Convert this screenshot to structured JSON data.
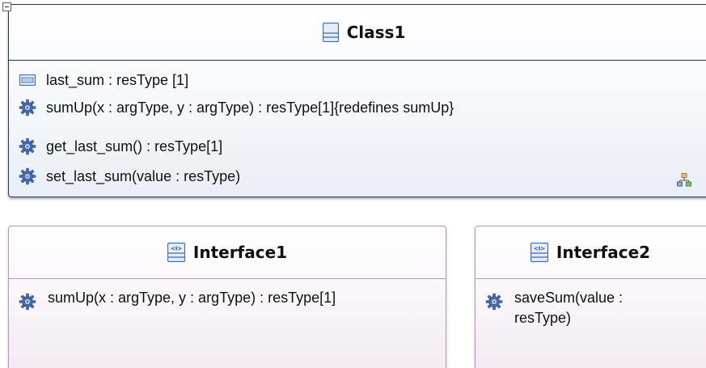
{
  "class1": {
    "name": "Class1",
    "attributes": [
      {
        "text": "last_sum : resType [1]",
        "icon": "property-icon"
      }
    ],
    "operations": [
      {
        "text": "sumUp(x : argType, y : argType) : resType[1]{redefines sumUp}",
        "icon": "operation-gear-icon"
      },
      {
        "text": "get_last_sum() : resType[1]",
        "icon": "operation-gear-icon"
      },
      {
        "text": "set_last_sum(value : resType)",
        "icon": "operation-gear-icon"
      }
    ]
  },
  "interface1": {
    "name": "Interface1",
    "operations": [
      {
        "text": "sumUp(x : argType, y : argType) : resType[1]",
        "icon": "operation-gear-icon"
      }
    ]
  },
  "interface2": {
    "name": "Interface2",
    "operations": [
      {
        "text": "saveSum(value : resType)",
        "icon": "operation-gear-icon"
      }
    ]
  },
  "colors": {
    "class_border": "#1f3a5f",
    "interface_border": "#b89ab8",
    "gear": "#4a6fb0"
  }
}
